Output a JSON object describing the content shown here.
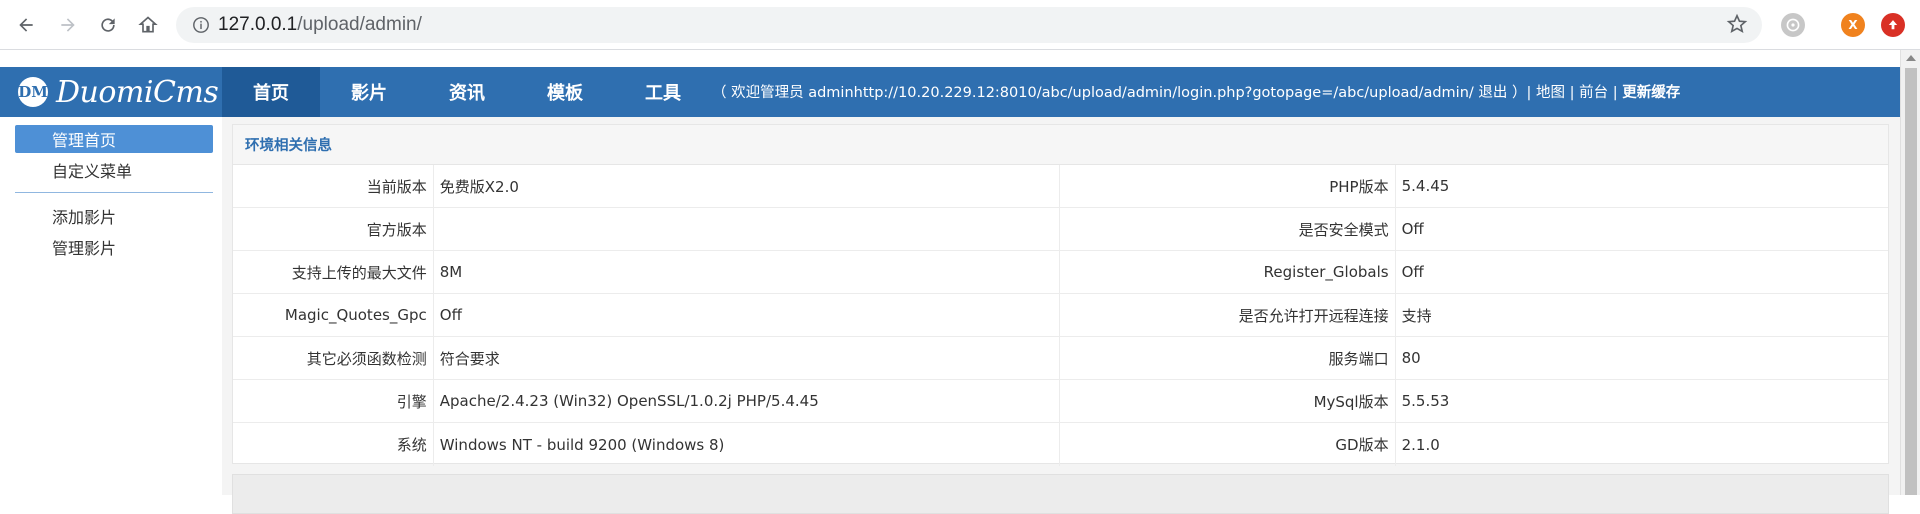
{
  "browser": {
    "url_host": "127.0.0.1",
    "url_path": "/upload/admin/",
    "ext1_letter": "X"
  },
  "app": {
    "logo_mark": "DM",
    "logo_text": "DuomiCms",
    "tabs": [
      {
        "label": "首页",
        "active": true
      },
      {
        "label": "影片",
        "active": false
      },
      {
        "label": "资讯",
        "active": false
      },
      {
        "label": "模板",
        "active": false
      },
      {
        "label": "工具",
        "active": false
      }
    ],
    "header_info": "（ 欢迎管理员 adminhttp://10.20.229.12:8010/abc/upload/admin/login.php?gotopage=/abc/upload/admin/  退出 ）| 地图 | 前台 | ",
    "header_info_bold": "更新缓存"
  },
  "sidebar": {
    "items": [
      {
        "label": "管理首页",
        "active": true
      },
      {
        "label": "自定义菜单",
        "active": false
      },
      {
        "label": "添加影片",
        "active": false
      },
      {
        "label": "管理影片",
        "active": false
      }
    ]
  },
  "panel": {
    "title": "环境相关信息",
    "rows": [
      {
        "l1": "当前版本",
        "v1": "免费版X2.0",
        "l2": "PHP版本",
        "v2": "5.4.45"
      },
      {
        "l1": "官方版本",
        "v1": "",
        "l2": "是否安全模式",
        "v2": "Off"
      },
      {
        "l1": "支持上传的最大文件",
        "v1": "8M",
        "l2": "Register_Globals",
        "v2": "Off"
      },
      {
        "l1": "Magic_Quotes_Gpc",
        "v1": "Off",
        "l2": "是否允许打开远程连接",
        "v2": "支持"
      },
      {
        "l1": "其它必须函数检测",
        "v1": "符合要求",
        "l2": "服务端口",
        "v2": "80"
      },
      {
        "l1": "引擎",
        "v1": "Apache/2.4.23 (Win32) OpenSSL/1.0.2j PHP/5.4.45",
        "l2": "MySql版本",
        "v2": "5.5.53"
      },
      {
        "l1": "系统",
        "v1": "Windows NT - build 9200 (Windows 8)",
        "l2": "GD版本",
        "v2": "2.1.0"
      }
    ]
  },
  "colors": {
    "header_blue": "#2f6fb0",
    "active_tab": "#1f5a97",
    "sidebar_active": "#4e90d6"
  }
}
